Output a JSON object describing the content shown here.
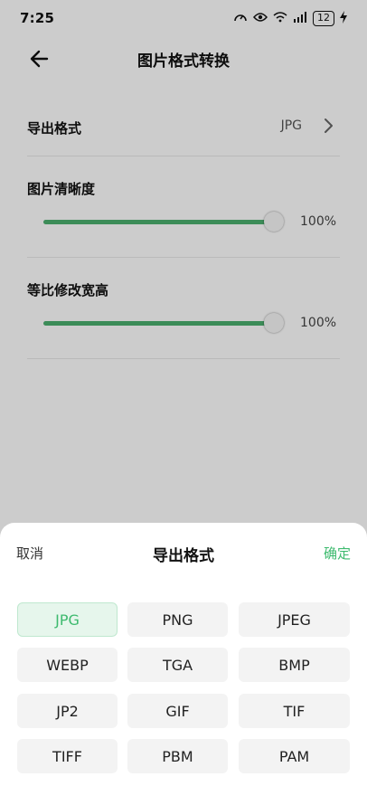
{
  "status_bar": {
    "time": "7:25",
    "battery": "12"
  },
  "header": {
    "title": "图片格式转换"
  },
  "settings": {
    "export_format": {
      "label": "导出格式",
      "value": "JPG"
    },
    "quality": {
      "label": "图片清晰度",
      "value_text": "100%",
      "level": 1.0
    },
    "scale": {
      "label": "等比修改宽高",
      "value_text": "100%",
      "level": 1.0
    }
  },
  "sheet": {
    "cancel_label": "取消",
    "title": "导出格式",
    "confirm_label": "确定",
    "options": [
      "JPG",
      "PNG",
      "JPEG",
      "WEBP",
      "TGA",
      "BMP",
      "JP2",
      "GIF",
      "TIF",
      "TIFF",
      "PBM",
      "PAM"
    ],
    "selected": "JPG"
  },
  "colors": {
    "accent": "#3dba6e",
    "slider_fill": "#4caf6e",
    "selected_bg": "#e6f6ec"
  }
}
